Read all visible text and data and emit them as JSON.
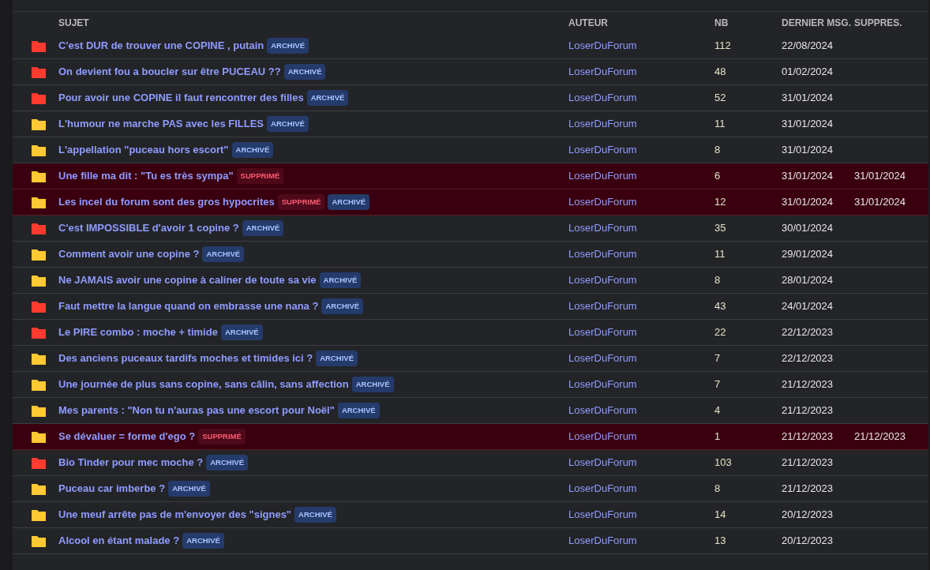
{
  "table": {
    "columns": [
      "SUJET",
      "AUTEUR",
      "NB",
      "DERNIER MSG.",
      "SUPPRES."
    ],
    "rows": [
      {
        "color": "#ff3b30",
        "subject": "C'est DUR de trouver une COPINE , putain",
        "deleted": false,
        "badges": [
          {
            "kind": "archived",
            "label": "ARCHIVÉ"
          }
        ],
        "author": "LoserDuForum",
        "count": "112",
        "last": "22/08/2024"
      },
      {
        "color": "#ff3b30",
        "subject": "On devient fou a boucler sur être PUCEAU ??",
        "deleted": false,
        "badges": [
          {
            "kind": "archived",
            "label": "ARCHIVÉ"
          }
        ],
        "author": "LoserDuForum",
        "count": "48",
        "last": "01/02/2024"
      },
      {
        "color": "#ff3b30",
        "subject": "Pour avoir une COPINE il faut rencontrer des filles",
        "deleted": false,
        "badges": [
          {
            "kind": "archived",
            "label": "ARCHIVÉ"
          }
        ],
        "author": "LoserDuForum",
        "count": "52",
        "last": "31/01/2024"
      },
      {
        "color": "#ffc933",
        "subject": "L'humour ne marche PAS avec les FILLES",
        "deleted": false,
        "badges": [
          {
            "kind": "archived",
            "label": "ARCHIVÉ"
          }
        ],
        "author": "LoserDuForum",
        "count": "11",
        "last": "31/01/2024"
      },
      {
        "color": "#ffc933",
        "subject": "L'appellation \"puceau hors escort\"",
        "deleted": false,
        "badges": [
          {
            "kind": "archived",
            "label": "ARCHIVÉ"
          }
        ],
        "author": "LoserDuForum",
        "count": "8",
        "last": "31/01/2024"
      },
      {
        "color": "#ffc933",
        "subject": "Une fille ma dit : \"Tu es très sympa\"",
        "deleted": true,
        "badges": [
          {
            "kind": "deleted",
            "label": "SUPPRIMÉ"
          }
        ],
        "author": "LoserDuForum",
        "count": "6",
        "last": "31/01/2024",
        "deleted_on": "31/01/2024"
      },
      {
        "color": "#ffc933",
        "subject": "Les incel du forum sont des gros hypocrites",
        "deleted": true,
        "badges": [
          {
            "kind": "deleted",
            "label": "SUPPRIMÉ"
          },
          {
            "kind": "archived",
            "label": "ARCHIVÉ"
          }
        ],
        "author": "LoserDuForum",
        "count": "12",
        "last": "31/01/2024",
        "deleted_on": "31/01/2024"
      },
      {
        "color": "#ff3b30",
        "subject": "C'est IMPOSSIBLE d'avoir 1 copine ?",
        "deleted": false,
        "badges": [
          {
            "kind": "archived",
            "label": "ARCHIVÉ"
          }
        ],
        "author": "LoserDuForum",
        "count": "35",
        "last": "30/01/2024"
      },
      {
        "color": "#ffc933",
        "subject": "Comment avoir une copine ?",
        "deleted": false,
        "badges": [
          {
            "kind": "archived",
            "label": "ARCHIVÉ"
          }
        ],
        "author": "LoserDuForum",
        "count": "11",
        "last": "29/01/2024"
      },
      {
        "color": "#ffc933",
        "subject": "Ne JAMAIS avoir une copine à caliner de toute sa vie",
        "deleted": false,
        "badges": [
          {
            "kind": "archived",
            "label": "ARCHIVÉ"
          }
        ],
        "author": "LoserDuForum",
        "count": "8",
        "last": "28/01/2024"
      },
      {
        "color": "#ff3b30",
        "subject": "Faut mettre la langue quand on embrasse une nana ?",
        "deleted": false,
        "badges": [
          {
            "kind": "archived",
            "label": "ARCHIVÉ"
          }
        ],
        "author": "LoserDuForum",
        "count": "43",
        "last": "24/01/2024"
      },
      {
        "color": "#ff3b30",
        "subject": "Le PIRE combo : moche + timide",
        "deleted": false,
        "badges": [
          {
            "kind": "archived",
            "label": "ARCHIVÉ"
          }
        ],
        "author": "LoserDuForum",
        "count": "22",
        "last": "22/12/2023"
      },
      {
        "color": "#ffc933",
        "subject": "Des anciens puceaux tardifs moches et timides ici ?",
        "deleted": false,
        "badges": [
          {
            "kind": "archived",
            "label": "ARCHIVÉ"
          }
        ],
        "author": "LoserDuForum",
        "count": "7",
        "last": "22/12/2023"
      },
      {
        "color": "#ffc933",
        "subject": "Une journée de plus sans copine, sans câlin, sans affection",
        "deleted": false,
        "badges": [
          {
            "kind": "archived",
            "label": "ARCHIVÉ"
          }
        ],
        "author": "LoserDuForum",
        "count": "7",
        "last": "21/12/2023"
      },
      {
        "color": "#ffc933",
        "subject": "Mes parents : \"Non tu n'auras pas une escort pour Noël\"",
        "deleted": false,
        "badges": [
          {
            "kind": "archived",
            "label": "ARCHIVÉ"
          }
        ],
        "author": "LoserDuForum",
        "count": "4",
        "last": "21/12/2023"
      },
      {
        "color": "#ffc933",
        "subject": "Se dévaluer = forme d'ego ?",
        "deleted": true,
        "badges": [
          {
            "kind": "deleted",
            "label": "SUPPRIMÉ"
          }
        ],
        "author": "LoserDuForum",
        "count": "1",
        "last": "21/12/2023",
        "deleted_on": "21/12/2023"
      },
      {
        "color": "#ff3b30",
        "subject": "Bio Tinder pour mec moche ?",
        "deleted": false,
        "badges": [
          {
            "kind": "archived",
            "label": "ARCHIVÉ"
          }
        ],
        "author": "LoserDuForum",
        "count": "103",
        "last": "21/12/2023"
      },
      {
        "color": "#ffc933",
        "subject": "Puceau car imberbe ?",
        "deleted": false,
        "badges": [
          {
            "kind": "archived",
            "label": "ARCHIVÉ"
          }
        ],
        "author": "LoserDuForum",
        "count": "8",
        "last": "21/12/2023"
      },
      {
        "color": "#ffc933",
        "subject": "Une meuf arrête pas de m'envoyer des \"signes\"",
        "deleted": false,
        "badges": [
          {
            "kind": "archived",
            "label": "ARCHIVÉ"
          }
        ],
        "author": "LoserDuForum",
        "count": "14",
        "last": "20/12/2023"
      },
      {
        "color": "#ffc933",
        "subject": "Alcool en étant malade ?",
        "deleted": false,
        "badges": [
          {
            "kind": "archived",
            "label": "ARCHIVÉ"
          }
        ],
        "author": "LoserDuForum",
        "count": "13",
        "last": "20/12/2023"
      }
    ]
  }
}
